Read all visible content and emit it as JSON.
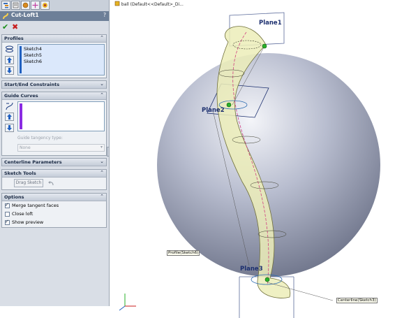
{
  "title": "Cut-Loft1",
  "help_label": "?",
  "ok_glyph": "✔",
  "cancel_glyph": "✖",
  "feature_tree_path": "ball  (Default<<Default>_Di...",
  "profiles": {
    "header": "Profiles",
    "items": [
      "Sketch4",
      "Sketch5",
      "Sketch6"
    ]
  },
  "start_end": {
    "header": "Start/End Constraints"
  },
  "guide_curves": {
    "header": "Guide Curves",
    "tangency_label": "Guide tangency type:",
    "tangency_value": "None"
  },
  "centerline": {
    "header": "Centerline Parameters"
  },
  "sketch_tools": {
    "header": "Sketch Tools",
    "drag_sketch": "Drag Sketch"
  },
  "options": {
    "header": "Options",
    "items": [
      {
        "label": "Merge tangent faces",
        "checked": true
      },
      {
        "label": "Close loft",
        "checked": false
      },
      {
        "label": "Show preview",
        "checked": true
      }
    ]
  },
  "graphics": {
    "planes": [
      "Plane1",
      "Plane2",
      "Plane3"
    ],
    "callouts": [
      "Profile(Sketch6)",
      "Centerline(Sketch3)"
    ]
  },
  "colors": {
    "panel_bg": "#d9dee6",
    "title_bar": "#6d7f98",
    "selection": "#dbe8fb",
    "guide_curve_bar": "#8a2be2",
    "sphere": "#8088a0",
    "loft": "#ecedb8"
  }
}
